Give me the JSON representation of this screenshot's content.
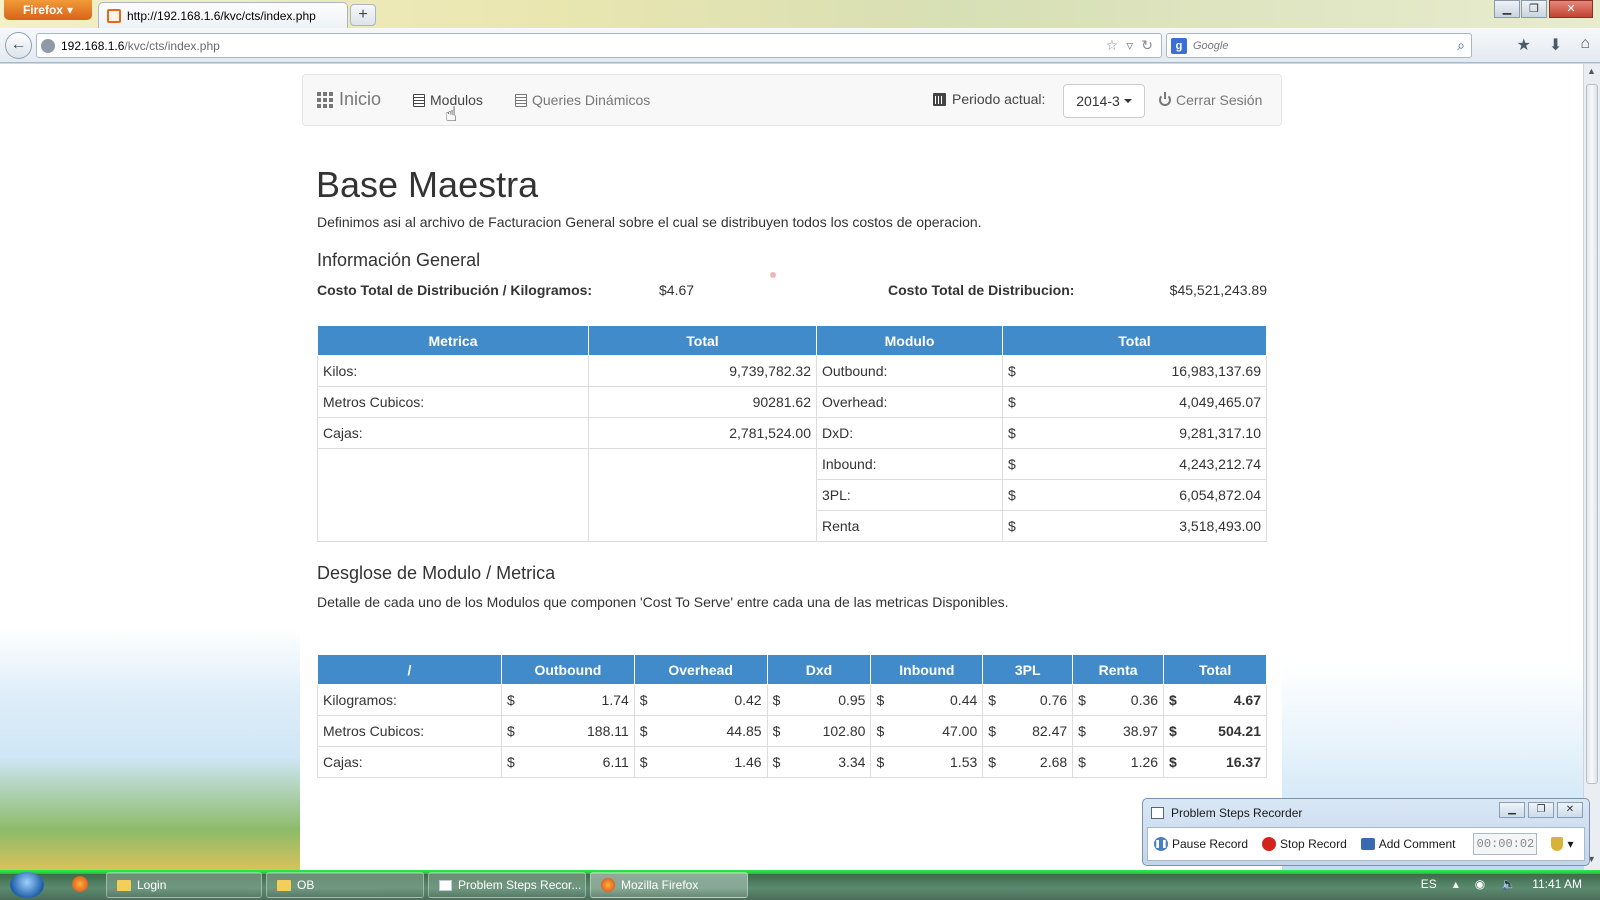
{
  "browser": {
    "menu_label": "Firefox",
    "tab_title": "http://192.168.1.6/kvc/cts/index.php",
    "url_host": "192.168.1.6",
    "url_path": "/kvc/cts/index.php",
    "search_placeholder": "Google"
  },
  "app_nav": {
    "brand": "Inicio",
    "links": [
      "Modulos",
      "Queries Dinámicos"
    ],
    "period_label": "Periodo actual:",
    "period_value": "2014-3",
    "logout": "Cerrar Sesión"
  },
  "page": {
    "title": "Base Maestra",
    "lead": "Definimos asi al archivo de Facturacion General sobre el cual se distribuyen todos los costos de operacion.",
    "info_heading": "Información General",
    "cost_per_kg_label": "Costo Total de Distribución / Kilogramos:",
    "cost_per_kg_value": "$4.67",
    "total_cost_label": "Costo Total de Distribucion:",
    "total_cost_value": "$45,521,243.89"
  },
  "summary_table": {
    "headers": [
      "Metrica",
      "Total",
      "Modulo",
      "Total"
    ],
    "metrics": [
      {
        "name": "Kilos:",
        "total": "9,739,782.32"
      },
      {
        "name": "Metros Cubicos:",
        "total": "90281.62"
      },
      {
        "name": "Cajas:",
        "total": "2,781,524.00"
      }
    ],
    "currency": "$",
    "modules": [
      {
        "name": "Outbound:",
        "total": "16,983,137.69"
      },
      {
        "name": "Overhead:",
        "total": "4,049,465.07"
      },
      {
        "name": "DxD:",
        "total": "9,281,317.10"
      },
      {
        "name": "Inbound:",
        "total": "4,243,212.74"
      },
      {
        "name": "3PL:",
        "total": "6,054,872.04"
      },
      {
        "name": "Renta",
        "total": "3,518,493.00"
      }
    ]
  },
  "breakdown": {
    "heading": "Desglose de Modulo / Metrica",
    "description": "Detalle de cada uno de los Modulos que componen 'Cost To Serve' entre cada una de las metricas Disponibles.",
    "headers": [
      "/",
      "Outbound",
      "Overhead",
      "Dxd",
      "Inbound",
      "3PL",
      "Renta",
      "Total"
    ],
    "currency": "$",
    "rows": [
      {
        "metric": "Kilogramos:",
        "values": [
          "1.74",
          "0.42",
          "0.95",
          "0.44",
          "0.76",
          "0.36"
        ],
        "total": "4.67"
      },
      {
        "metric": "Metros Cubicos:",
        "values": [
          "188.11",
          "44.85",
          "102.80",
          "47.00",
          "82.47",
          "38.97"
        ],
        "total": "504.21"
      },
      {
        "metric": "Cajas:",
        "values": [
          "6.11",
          "1.46",
          "3.34",
          "1.53",
          "2.68",
          "1.26"
        ],
        "total": "16.37"
      }
    ]
  },
  "psr": {
    "title": "Problem Steps Recorder",
    "pause": "Pause Record",
    "stop": "Stop Record",
    "comment": "Add Comment",
    "timer": "00:00:02"
  },
  "taskbar": {
    "tasks": [
      "Login",
      "OB",
      "Problem Steps Recor...",
      "Mozilla Firefox"
    ],
    "lang": "ES",
    "time": "11:41 AM"
  },
  "colors": {
    "table_header": "#428bca",
    "firefox_orange": "#e66000"
  }
}
